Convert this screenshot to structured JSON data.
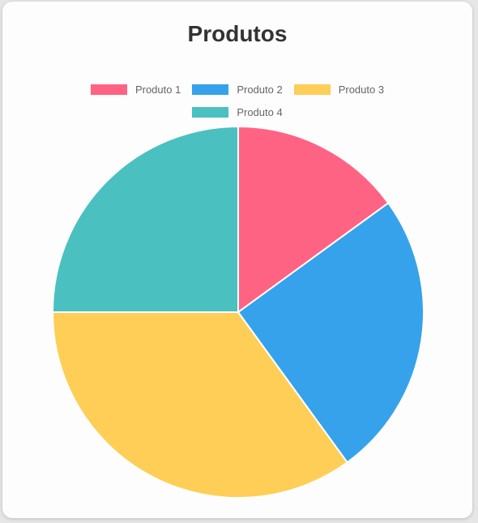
{
  "chart_data": {
    "type": "pie",
    "title": "Produtos",
    "legend_position": "top",
    "categories": [
      "Produto 1",
      "Produto 2",
      "Produto 3",
      "Produto 4"
    ],
    "values": [
      15,
      25,
      35,
      25
    ],
    "colors": [
      "#ff6384",
      "#36a2eb",
      "#ffce56",
      "#4bc0c0"
    ]
  }
}
